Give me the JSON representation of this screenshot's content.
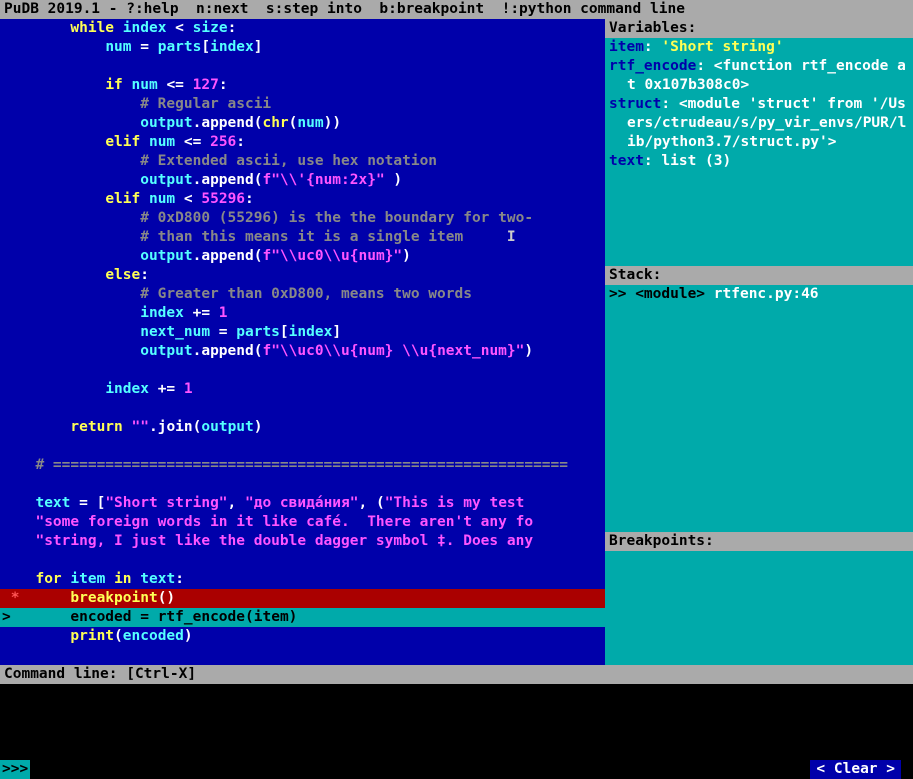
{
  "header": "PuDB 2019.1 - ?:help  n:next  s:step into  b:breakpoint  !:python command line",
  "source": {
    "lines": [
      {
        "gutter": "  ",
        "segs": [
          {
            "t": "      ",
            "c": ""
          },
          {
            "t": "while",
            "c": "kw"
          },
          {
            "t": " ",
            "c": ""
          },
          {
            "t": "index",
            "c": "id"
          },
          {
            "t": " < ",
            "c": "op"
          },
          {
            "t": "size",
            "c": "id"
          },
          {
            "t": ":",
            "c": "op"
          }
        ]
      },
      {
        "gutter": "  ",
        "segs": [
          {
            "t": "          ",
            "c": ""
          },
          {
            "t": "num",
            "c": "id"
          },
          {
            "t": " = ",
            "c": "op"
          },
          {
            "t": "parts",
            "c": "id"
          },
          {
            "t": "[",
            "c": "pn"
          },
          {
            "t": "index",
            "c": "id"
          },
          {
            "t": "]",
            "c": "pn"
          }
        ]
      },
      {
        "gutter": "  ",
        "segs": []
      },
      {
        "gutter": "  ",
        "segs": [
          {
            "t": "          ",
            "c": ""
          },
          {
            "t": "if",
            "c": "kw"
          },
          {
            "t": " ",
            "c": ""
          },
          {
            "t": "num",
            "c": "id"
          },
          {
            "t": " <= ",
            "c": "op"
          },
          {
            "t": "127",
            "c": "num"
          },
          {
            "t": ":",
            "c": "op"
          }
        ]
      },
      {
        "gutter": "  ",
        "segs": [
          {
            "t": "              ",
            "c": ""
          },
          {
            "t": "# Regular ascii",
            "c": "cmt"
          }
        ]
      },
      {
        "gutter": "  ",
        "segs": [
          {
            "t": "              ",
            "c": ""
          },
          {
            "t": "output",
            "c": "id"
          },
          {
            "t": ".",
            "c": "op"
          },
          {
            "t": "append",
            "c": "fn"
          },
          {
            "t": "(",
            "c": "pn"
          },
          {
            "t": "chr",
            "c": "kw"
          },
          {
            "t": "(",
            "c": "pn"
          },
          {
            "t": "num",
            "c": "id"
          },
          {
            "t": "))",
            "c": "pn"
          }
        ]
      },
      {
        "gutter": "  ",
        "segs": [
          {
            "t": "          ",
            "c": ""
          },
          {
            "t": "elif",
            "c": "kw"
          },
          {
            "t": " ",
            "c": ""
          },
          {
            "t": "num",
            "c": "id"
          },
          {
            "t": " <= ",
            "c": "op"
          },
          {
            "t": "256",
            "c": "num"
          },
          {
            "t": ":",
            "c": "op"
          }
        ]
      },
      {
        "gutter": "  ",
        "segs": [
          {
            "t": "              ",
            "c": ""
          },
          {
            "t": "# Extended ascii, use hex notation",
            "c": "cmt"
          }
        ]
      },
      {
        "gutter": "  ",
        "segs": [
          {
            "t": "              ",
            "c": ""
          },
          {
            "t": "output",
            "c": "id"
          },
          {
            "t": ".",
            "c": "op"
          },
          {
            "t": "append",
            "c": "fn"
          },
          {
            "t": "(",
            "c": "pn"
          },
          {
            "t": "f\"\\\\'{num:2x}\"",
            "c": "str"
          },
          {
            "t": " )",
            "c": "pn"
          }
        ]
      },
      {
        "gutter": "  ",
        "segs": [
          {
            "t": "          ",
            "c": ""
          },
          {
            "t": "elif",
            "c": "kw"
          },
          {
            "t": " ",
            "c": ""
          },
          {
            "t": "num",
            "c": "id"
          },
          {
            "t": " < ",
            "c": "op"
          },
          {
            "t": "55296",
            "c": "num"
          },
          {
            "t": ":",
            "c": "op"
          }
        ]
      },
      {
        "gutter": "  ",
        "segs": [
          {
            "t": "              ",
            "c": ""
          },
          {
            "t": "# 0xD800 (55296) is the the boundary for two-",
            "c": "cmt"
          }
        ]
      },
      {
        "gutter": "  ",
        "segs": [
          {
            "t": "              ",
            "c": ""
          },
          {
            "t": "# than this means it is a single item     ",
            "c": "cmt"
          },
          {
            "t": "I",
            "c": "cursor"
          }
        ]
      },
      {
        "gutter": "  ",
        "segs": [
          {
            "t": "              ",
            "c": ""
          },
          {
            "t": "output",
            "c": "id"
          },
          {
            "t": ".",
            "c": "op"
          },
          {
            "t": "append",
            "c": "fn"
          },
          {
            "t": "(",
            "c": "pn"
          },
          {
            "t": "f\"\\\\uc0\\\\u{num}\"",
            "c": "str"
          },
          {
            "t": ")",
            "c": "pn"
          }
        ]
      },
      {
        "gutter": "  ",
        "segs": [
          {
            "t": "          ",
            "c": ""
          },
          {
            "t": "else",
            "c": "kw"
          },
          {
            "t": ":",
            "c": "op"
          }
        ]
      },
      {
        "gutter": "  ",
        "segs": [
          {
            "t": "              ",
            "c": ""
          },
          {
            "t": "# Greater than 0xD800, means two words",
            "c": "cmt"
          }
        ]
      },
      {
        "gutter": "  ",
        "segs": [
          {
            "t": "              ",
            "c": ""
          },
          {
            "t": "index",
            "c": "id"
          },
          {
            "t": " += ",
            "c": "op"
          },
          {
            "t": "1",
            "c": "num"
          }
        ]
      },
      {
        "gutter": "  ",
        "segs": [
          {
            "t": "              ",
            "c": ""
          },
          {
            "t": "next_num",
            "c": "id"
          },
          {
            "t": " = ",
            "c": "op"
          },
          {
            "t": "parts",
            "c": "id"
          },
          {
            "t": "[",
            "c": "pn"
          },
          {
            "t": "index",
            "c": "id"
          },
          {
            "t": "]",
            "c": "pn"
          }
        ]
      },
      {
        "gutter": "  ",
        "segs": [
          {
            "t": "              ",
            "c": ""
          },
          {
            "t": "output",
            "c": "id"
          },
          {
            "t": ".",
            "c": "op"
          },
          {
            "t": "append",
            "c": "fn"
          },
          {
            "t": "(",
            "c": "pn"
          },
          {
            "t": "f\"\\\\uc0\\\\u{num} \\\\u{next_num}\"",
            "c": "str"
          },
          {
            "t": ")",
            "c": "pn"
          }
        ]
      },
      {
        "gutter": "  ",
        "segs": []
      },
      {
        "gutter": "  ",
        "segs": [
          {
            "t": "          ",
            "c": ""
          },
          {
            "t": "index",
            "c": "id"
          },
          {
            "t": " += ",
            "c": "op"
          },
          {
            "t": "1",
            "c": "num"
          }
        ]
      },
      {
        "gutter": "  ",
        "segs": []
      },
      {
        "gutter": "  ",
        "segs": [
          {
            "t": "      ",
            "c": ""
          },
          {
            "t": "return",
            "c": "kw"
          },
          {
            "t": " ",
            "c": ""
          },
          {
            "t": "\"\"",
            "c": "str"
          },
          {
            "t": ".",
            "c": "op"
          },
          {
            "t": "join",
            "c": "fn"
          },
          {
            "t": "(",
            "c": "pn"
          },
          {
            "t": "output",
            "c": "id"
          },
          {
            "t": ")",
            "c": "pn"
          }
        ]
      },
      {
        "gutter": "  ",
        "segs": []
      },
      {
        "gutter": "  ",
        "segs": [
          {
            "t": "  ",
            "c": ""
          },
          {
            "t": "# ===========================================================",
            "c": "cmt"
          }
        ]
      },
      {
        "gutter": "  ",
        "segs": []
      },
      {
        "gutter": "  ",
        "segs": [
          {
            "t": "  ",
            "c": ""
          },
          {
            "t": "text",
            "c": "id"
          },
          {
            "t": " = [",
            "c": "op"
          },
          {
            "t": "\"Short string\"",
            "c": "str"
          },
          {
            "t": ", ",
            "c": "op"
          },
          {
            "t": "\"до свида́ния\"",
            "c": "str"
          },
          {
            "t": ", (",
            "c": "op"
          },
          {
            "t": "\"This is my test ",
            "c": "str"
          }
        ]
      },
      {
        "gutter": "  ",
        "segs": [
          {
            "t": "  ",
            "c": ""
          },
          {
            "t": "\"some foreign words in it like café.  There aren't any fo",
            "c": "str"
          }
        ]
      },
      {
        "gutter": "  ",
        "segs": [
          {
            "t": "  ",
            "c": ""
          },
          {
            "t": "\"string, I just like the double dagger symbol ‡. Does any",
            "c": "str"
          }
        ]
      },
      {
        "gutter": "  ",
        "segs": []
      },
      {
        "gutter": "  ",
        "segs": [
          {
            "t": "  ",
            "c": ""
          },
          {
            "t": "for",
            "c": "kw"
          },
          {
            "t": " ",
            "c": ""
          },
          {
            "t": "item",
            "c": "id"
          },
          {
            "t": " ",
            "c": ""
          },
          {
            "t": "in",
            "c": "kw"
          },
          {
            "t": " ",
            "c": ""
          },
          {
            "t": "text",
            "c": "id"
          },
          {
            "t": ":",
            "c": "op"
          }
        ]
      },
      {
        "gutter": " *",
        "cls": "bp-line",
        "segs": [
          {
            "t": "      ",
            "c": ""
          },
          {
            "t": "breakpoint",
            "c": "kw"
          },
          {
            "t": "()",
            "c": "pn"
          }
        ]
      },
      {
        "gutter": "> ",
        "cls": "cur-line",
        "segs": [
          {
            "t": "      ",
            "c": ""
          },
          {
            "t": "encoded",
            "c": "id"
          },
          {
            "t": " = ",
            "c": "op"
          },
          {
            "t": "rtf_encode",
            "c": "fn"
          },
          {
            "t": "(",
            "c": "pn"
          },
          {
            "t": "item",
            "c": "id"
          },
          {
            "t": ")",
            "c": "pn"
          }
        ]
      },
      {
        "gutter": "  ",
        "segs": [
          {
            "t": "      ",
            "c": ""
          },
          {
            "t": "print",
            "c": "kw"
          },
          {
            "t": "(",
            "c": "pn"
          },
          {
            "t": "encoded",
            "c": "id"
          },
          {
            "t": ")",
            "c": "pn"
          }
        ]
      }
    ]
  },
  "variables": {
    "title": "Variables:",
    "entries": [
      {
        "key": "item",
        "sep": ": ",
        "val": "'Short string'",
        "vc": "var-val"
      },
      {
        "key": "rtf_encode",
        "sep": ": ",
        "val": "<function rtf_encode at 0x107b308c0>",
        "vc": "var-val-w"
      },
      {
        "key": "struct",
        "sep": ": ",
        "val": "<module 'struct' from '/Users/ctrudeau/s/py_vir_envs/PUR/lib/python3.7/struct.py'>",
        "vc": "var-val-w"
      },
      {
        "key": "text",
        "sep": ": ",
        "val": "list (3)",
        "vc": "var-val-w"
      }
    ]
  },
  "stack": {
    "title": "Stack:",
    "frame_prefix": ">> ",
    "frame_mod": "<module>",
    "frame_loc": " rtfenc.py:46"
  },
  "breakpoints": {
    "title": "Breakpoints:"
  },
  "cmdline": {
    "label": "Command line: [Ctrl-X]",
    "prompt": ">>>",
    "clear": "< Clear >"
  }
}
